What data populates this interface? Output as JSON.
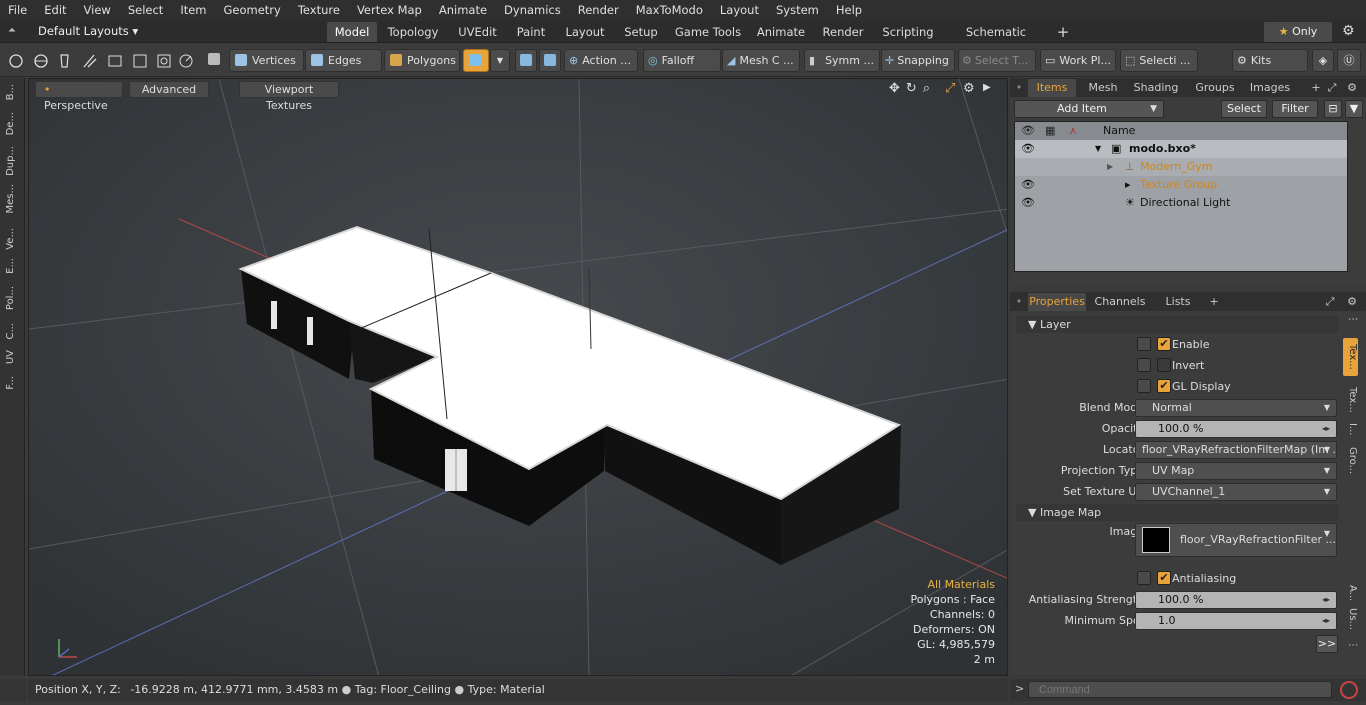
{
  "menu": [
    "File",
    "Edit",
    "View",
    "Select",
    "Item",
    "Geometry",
    "Texture",
    "Vertex Map",
    "Animate",
    "Dynamics",
    "Render",
    "MaxToModo",
    "Layout",
    "System",
    "Help"
  ],
  "layouts": {
    "preset": "Default Layouts ▾",
    "tabs": [
      "Model",
      "Topology",
      "UVEdit",
      "Paint",
      "Layout",
      "Setup",
      "Game Tools",
      "Animate",
      "Render",
      "Scripting",
      "Schematic Fusion"
    ],
    "plus": "+",
    "only": "Only"
  },
  "toolbar": {
    "vertices": "Vertices",
    "edges": "Edges",
    "polygons": "Polygons",
    "action": "Action",
    "falloff": "Falloff",
    "meshc": "Mesh C ...",
    "symm": "Symm ...",
    "snapping": "Snapping",
    "selectt": "Select T...",
    "workpl": "Work Pl...",
    "selecti": "Selecti ...",
    "kits": "Kits"
  },
  "leftstrip": [
    "B...",
    "De...",
    "Dup...",
    "Mes...",
    "Ve...",
    "E...",
    "Pol...",
    "C...",
    "UV",
    "F..."
  ],
  "viewport": {
    "perspective": "Perspective",
    "advanced": "Advanced",
    "textures": "Viewport Textures",
    "hud": {
      "materials": "All Materials",
      "polygons": "Polygons : Face",
      "channels": "Channels: 0",
      "deformers": "Deformers: ON",
      "gl": "GL: 4,985,579",
      "scale": "2 m"
    }
  },
  "items_panel": {
    "tabs": [
      "Items",
      "Mesh ...",
      "Shading",
      "Groups",
      "Images"
    ],
    "plus": "+",
    "add_item": "Add Item",
    "select": "Select",
    "filter": "Filter",
    "name_header": "Name",
    "rows": [
      {
        "label": "modo.bxo*"
      },
      {
        "label": "Modern_Gym"
      },
      {
        "label": "Texture Group"
      },
      {
        "label": "Directional Light"
      }
    ]
  },
  "properties": {
    "tabs": [
      "Properties",
      "Channels",
      "Lists"
    ],
    "plus": "+",
    "layer_section": "Layer",
    "enable": "Enable",
    "invert": "Invert",
    "gl_display": "GL Display",
    "blend_mode_label": "Blend Mode",
    "blend_mode": "Normal",
    "opacity_label": "Opacity",
    "opacity": "100.0 %",
    "locator_label": "Locator",
    "locator": "floor_VRayRefractionFilterMap (Im ...",
    "projection_label": "Projection Type",
    "projection": "UV Map",
    "setuv_label": "Set Texture UV",
    "setuv": "UVChannel_1",
    "image_map_section": "Image Map",
    "image_label": "Image",
    "image": "floor_VRayRefractionFilter ...",
    "antialiasing": "Antialiasing",
    "aa_strength_label": "Antialiasing Strength",
    "aa_strength": "100.0 %",
    "min_spot_label": "Minimum Spot",
    "min_spot": "1.0",
    "more": ">>"
  },
  "rstrip": [
    "Tex...",
    "Tex...",
    "I...",
    "Gro...",
    "A...",
    "Us..."
  ],
  "status": {
    "position_label": "Position X, Y, Z:",
    "position_value": "-16.9228 m, 412.9771 mm, 3.4583 m",
    "tag_label": "Tag:",
    "tag_value": "Floor_Ceiling",
    "type_label": "Type:",
    "type_value": "Material"
  },
  "command_placeholder": "Command",
  "colors": {
    "accent": "#e8a33b",
    "viewport_bg": "#3a3d40"
  }
}
